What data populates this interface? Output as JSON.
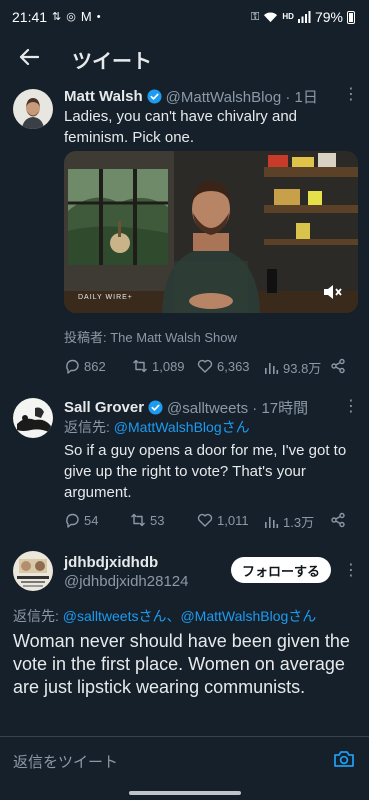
{
  "status_bar": {
    "time": "21:41",
    "left_icons": [
      "signal-speed-icon",
      "notification-icon",
      "gmail-icon",
      "dot-icon"
    ],
    "right_icons": [
      "key-icon",
      "wifi-icon",
      "hd-icon",
      "cellular-icon"
    ],
    "hd": "HD",
    "battery": "79%"
  },
  "header": {
    "title": "ツイート"
  },
  "tweet1": {
    "name": "Matt Walsh",
    "handle": "@MattWalshBlog · 1日",
    "text": "Ladies, you can't have chivalry and feminism. Pick one.",
    "video_watermark": "DAILY WIRE+",
    "posted_by": "投稿者: The Matt Walsh Show",
    "replies": "862",
    "retweets": "1,089",
    "likes": "6,363",
    "views": "93.8万"
  },
  "tweet2": {
    "name": "Sall Grover",
    "handle": "@salltweets · 17時間",
    "reply_prefix": "返信先: ",
    "reply_mention": "@MattWalshBlogさん",
    "text": "So if a guy opens a door for me, I've got to give up the right to vote? That's your argument.",
    "replies": "54",
    "retweets": "53",
    "likes": "1,011",
    "views": "1.3万"
  },
  "tweet3": {
    "name": "jdhbdjxidhdb",
    "handle": "@jdhbdjxidh28124",
    "follow_label": "フォローする",
    "reply_prefix": "返信先: ",
    "reply_mention": "@salltweetsさん、@MattWalshBlogさん",
    "text": "Woman never should have been given the vote in the first place. Women on average are just lipstick wearing communists."
  },
  "compose": {
    "placeholder": "返信をツイート"
  },
  "colors": {
    "background": "#15202b",
    "accent": "#1d9bf0",
    "muted": "#8b98a5",
    "text": "#e7e9ea"
  }
}
